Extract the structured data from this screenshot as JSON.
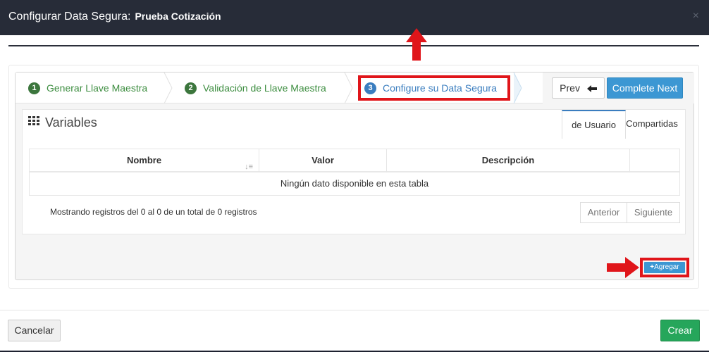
{
  "modal": {
    "title": "Configurar Data Segura:",
    "subtitle": "Prueba Cotización",
    "close_icon": "close-icon"
  },
  "wizard": {
    "steps": [
      {
        "number": "1",
        "label": "Generar Llave Maestra",
        "state": "done"
      },
      {
        "number": "2",
        "label": "Validación de Llave Maestra",
        "state": "done"
      },
      {
        "number": "3",
        "label": "Configure su Data Segura",
        "state": "active"
      }
    ],
    "prev_label": "Prev",
    "prev_icon": "arrow-left-icon",
    "complete_label": "Complete Next"
  },
  "panel": {
    "title": "Variables",
    "title_icon": "grid-icon",
    "tabs": [
      {
        "label": "de Usuario",
        "active": true
      },
      {
        "label": "Compartidas",
        "active": false
      }
    ]
  },
  "table": {
    "columns": [
      "Nombre",
      "Valor",
      "Descripción",
      ""
    ],
    "empty_message": "Ningún dato disponible en esta tabla",
    "info": "Mostrando registros del 0 al 0 de un total de 0 registros",
    "pager": {
      "previous": "Anterior",
      "next": "Siguiente"
    }
  },
  "actions": {
    "add_label": "Agregar",
    "add_icon": "plus-icon"
  },
  "footer": {
    "cancel_label": "Cancelar",
    "create_label": "Crear"
  },
  "colors": {
    "header_bg": "#272c38",
    "step_done": "#3c763d",
    "step_active": "#3a7dbf",
    "primary": "#3c97d3",
    "success": "#26a65b",
    "annotation_red": "#e0151a"
  }
}
